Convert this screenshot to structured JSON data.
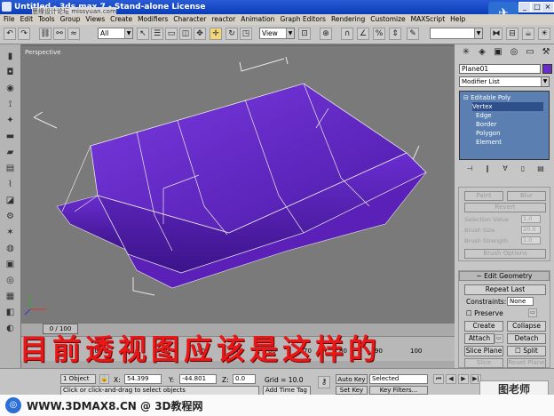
{
  "titlebar": {
    "title": "Untitled - 3ds max 7 - Stand-alone License",
    "watermark": "思缘设计论坛 missyuan.com"
  },
  "window_buttons": {
    "minimize": "_",
    "maximize": "□",
    "close": "×"
  },
  "menu": [
    "File",
    "Edit",
    "Tools",
    "Group",
    "Views",
    "Create",
    "Modifiers",
    "Character",
    "reactor",
    "Animation",
    "Graph Editors",
    "Rendering",
    "Customize",
    "MAXScript",
    "Help"
  ],
  "toolbar": {
    "selection_filter": "All",
    "ref_coord": "View"
  },
  "viewport": {
    "label": "Perspective",
    "object_color": "#6a2dc8"
  },
  "command_panel": {
    "object_name": "Plane01",
    "modifier_list": "Modifier List",
    "stack": [
      "Editable Poly",
      "Vertex",
      "Edge",
      "Border",
      "Polygon",
      "Element"
    ],
    "paint_rollout": {
      "paint": "Paint",
      "blur": "Blur",
      "revert": "Revert",
      "selection_value_label": "Selection Value",
      "selection_value": "1.0",
      "brush_size_label": "Brush Size",
      "brush_size": "20.0",
      "brush_strength_label": "Brush Strength",
      "brush_strength": "1.0",
      "brush_options": "Brush Options"
    },
    "edit_geometry": {
      "header": "Edit Geometry",
      "repeat_last": "Repeat Last",
      "constraints_label": "Constraints:",
      "constraints_value": "None",
      "preserve": "Preserve",
      "create": "Create",
      "collapse": "Collapse",
      "attach": "Attach",
      "detach": "Detach",
      "slice_plane": "Slice Plane",
      "split": "Split",
      "slice": "Slice",
      "reset_plane": "Reset Plane"
    }
  },
  "timeline": {
    "slider": "0 / 100",
    "ticks": [
      "0",
      "10",
      "20",
      "30",
      "40",
      "50",
      "60",
      "70",
      "80",
      "90",
      "100"
    ]
  },
  "overlay_caption": "目前透视图应该是这样的",
  "status": {
    "objects": "1 Object",
    "prompt": "Click or click-and-drag to select objects",
    "x_label": "X:",
    "x": "54.399",
    "y_label": "Y:",
    "y": "-44.801",
    "z_label": "Z:",
    "z": "0.0",
    "grid": "Grid = 10.0",
    "add_time_tag": "Add Time Tag",
    "auto_key": "Auto Key",
    "auto_key_mode": "Selected",
    "set_key": "Set Key",
    "key_filters": "Key Filters..."
  },
  "footer": {
    "text": "WWW.3DMAX8.CN @ 3D教程网",
    "brand": "图老师"
  }
}
